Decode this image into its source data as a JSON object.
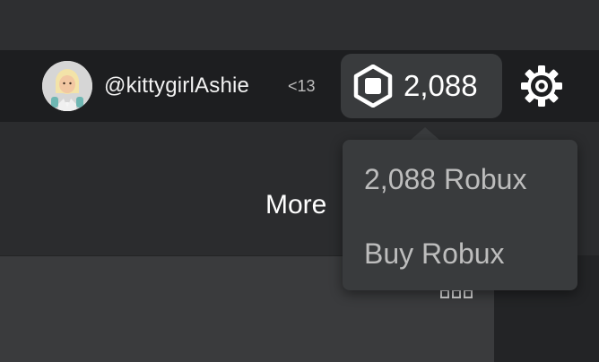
{
  "header": {
    "username": "@kittygirlAshie",
    "age_badge": "<13",
    "robux_balance": "2,088",
    "icons": {
      "avatar": "user-avatar",
      "robux": "robux-icon",
      "settings": "gear-icon"
    }
  },
  "robux_menu": {
    "items": [
      {
        "label": "2,088 Robux"
      },
      {
        "label": "Buy Robux"
      }
    ]
  },
  "main": {
    "section_title": "More",
    "more_options_icon": "more-options-icon"
  },
  "colors": {
    "background": "#2b2c2e",
    "header": "#1d1e20",
    "pill": "#393b3d",
    "dropdown": "#393b3d",
    "text_primary": "#ffffff",
    "text_secondary": "#bdbdbd"
  }
}
